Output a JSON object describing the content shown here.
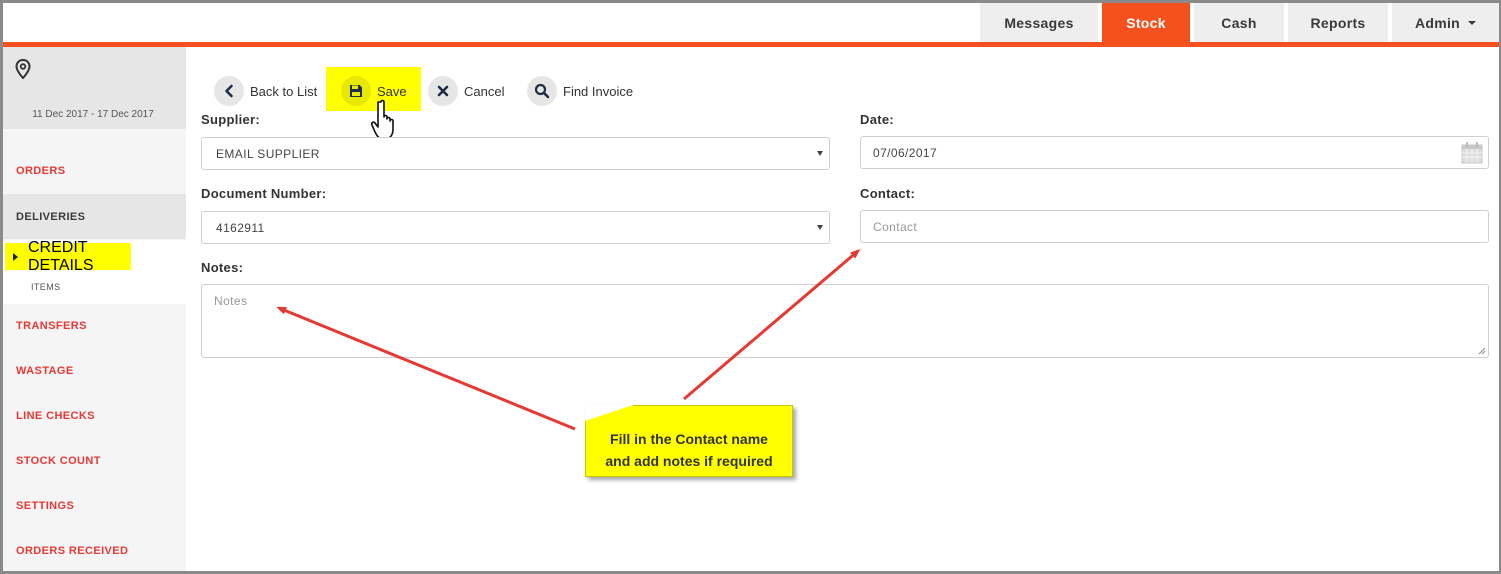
{
  "nav": {
    "messages": "Messages",
    "stock": "Stock",
    "cash": "Cash",
    "reports": "Reports",
    "admin": "Admin"
  },
  "sidebar": {
    "date_range": "11 Dec 2017 - 17 Dec 2017",
    "items": {
      "orders": "ORDERS",
      "deliveries": "DELIVERIES",
      "credit_details": "CREDIT DETAILS",
      "items": "ITEMS",
      "transfers": "TRANSFERS",
      "wastage": "WASTAGE",
      "line_checks": "LINE CHECKS",
      "stock_count": "STOCK COUNT",
      "settings": "SETTINGS",
      "orders_received": "ORDERS RECEIVED"
    }
  },
  "toolbar": {
    "back": "Back to List",
    "save": "Save",
    "cancel": "Cancel",
    "find": "Find Invoice"
  },
  "form": {
    "supplier_label": "Supplier:",
    "supplier_value": "EMAIL SUPPLIER",
    "date_label": "Date:",
    "date_value": "07/06/2017",
    "doc_label": "Document Number:",
    "doc_value": "4162911",
    "contact_label": "Contact:",
    "contact_placeholder": "Contact",
    "notes_label": "Notes:",
    "notes_placeholder": "Notes"
  },
  "callout": {
    "line1": "Fill in the Contact name",
    "line2": "and add notes if required"
  },
  "colors": {
    "accent": "#f4511e",
    "sidebar_link": "#e53935",
    "highlight": "#ffff00",
    "arrow": "#e53935"
  }
}
